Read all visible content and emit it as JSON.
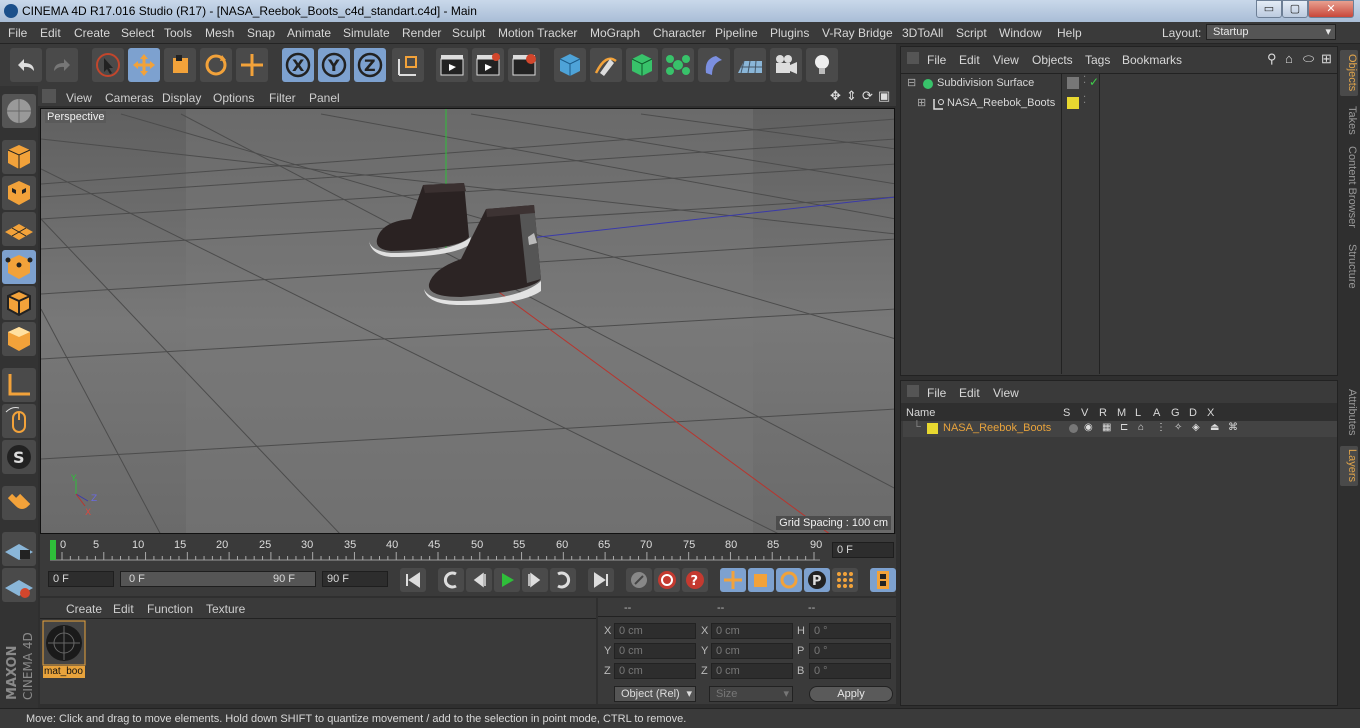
{
  "title": {
    "text": "CINEMA 4D R17.016 Studio (R17) - [NASA_Reebok_Boots_c4d_standart.c4d] - Main",
    "min": "▭",
    "max": "▢",
    "close": "✕"
  },
  "menu": [
    "File",
    "Edit",
    "Create",
    "Select",
    "Tools",
    "Mesh",
    "Snap",
    "Animate",
    "Simulate",
    "Render",
    "Sculpt",
    "Motion Tracker",
    "MoGraph",
    "Character",
    "Pipeline",
    "Plugins",
    "V-Ray Bridge",
    "3DToAll",
    "Script",
    "Window",
    "Help"
  ],
  "layout": {
    "label": "Layout:",
    "value": "Startup"
  },
  "viewport": {
    "menu": [
      "View",
      "Cameras",
      "Display",
      "Options",
      "Filter",
      "Panel"
    ],
    "camera_label": "Perspective",
    "grid_spacing": "Grid Spacing : 100 cm",
    "axis_labels": {
      "x": "X",
      "y": "Y",
      "z": "Z"
    }
  },
  "timeline": {
    "ticks": [
      "0",
      "5",
      "10",
      "15",
      "20",
      "25",
      "30",
      "35",
      "40",
      "45",
      "50",
      "55",
      "60",
      "65",
      "70",
      "75",
      "80",
      "85",
      "90"
    ],
    "current_frame": "0 F"
  },
  "transport": {
    "start": "0 F",
    "range_start": "0 F",
    "range_end": "90 F",
    "end": "90 F"
  },
  "materials": {
    "menu": [
      "Create",
      "Edit",
      "Function",
      "Texture"
    ],
    "items": [
      {
        "name": "mat_boo"
      }
    ]
  },
  "coords": {
    "headers": [
      "--",
      "--",
      "--"
    ],
    "rows": [
      {
        "a": "X",
        "av": "0 cm",
        "b": "X",
        "bv": "0 cm",
        "c": "H",
        "cv": "0 °"
      },
      {
        "a": "Y",
        "av": "0 cm",
        "b": "Y",
        "bv": "0 cm",
        "c": "P",
        "cv": "0 °"
      },
      {
        "a": "Z",
        "av": "0 cm",
        "b": "Z",
        "bv": "0 cm",
        "c": "B",
        "cv": "0 °"
      }
    ],
    "mode": "Object (Rel)",
    "size": "Size",
    "apply": "Apply"
  },
  "objects": {
    "menu": [
      "File",
      "Edit",
      "View",
      "Objects",
      "Tags",
      "Bookmarks"
    ],
    "items": [
      {
        "name": "Subdivision Surface"
      },
      {
        "name": "NASA_Reebok_Boots"
      }
    ]
  },
  "layers": {
    "menu": [
      "File",
      "Edit",
      "View"
    ],
    "columns": [
      "Name",
      "S",
      "V",
      "R",
      "M",
      "L",
      "A",
      "G",
      "D",
      "X"
    ],
    "items": [
      {
        "name": "NASA_Reebok_Boots",
        "color": "#e8d830"
      }
    ]
  },
  "right_tabs": [
    "Objects",
    "Takes",
    "Content Browser",
    "Structure",
    "Attributes",
    "Layers"
  ],
  "brand": {
    "maxon": "MAXON",
    "product": "CINEMA 4D"
  },
  "status": "Move: Click and drag to move elements. Hold down SHIFT to quantize movement / add to the selection in point mode, CTRL to remove.",
  "colors": {
    "accent": "#7da1cf",
    "highlight": "#e8a33c",
    "layer": "#e8d830"
  }
}
